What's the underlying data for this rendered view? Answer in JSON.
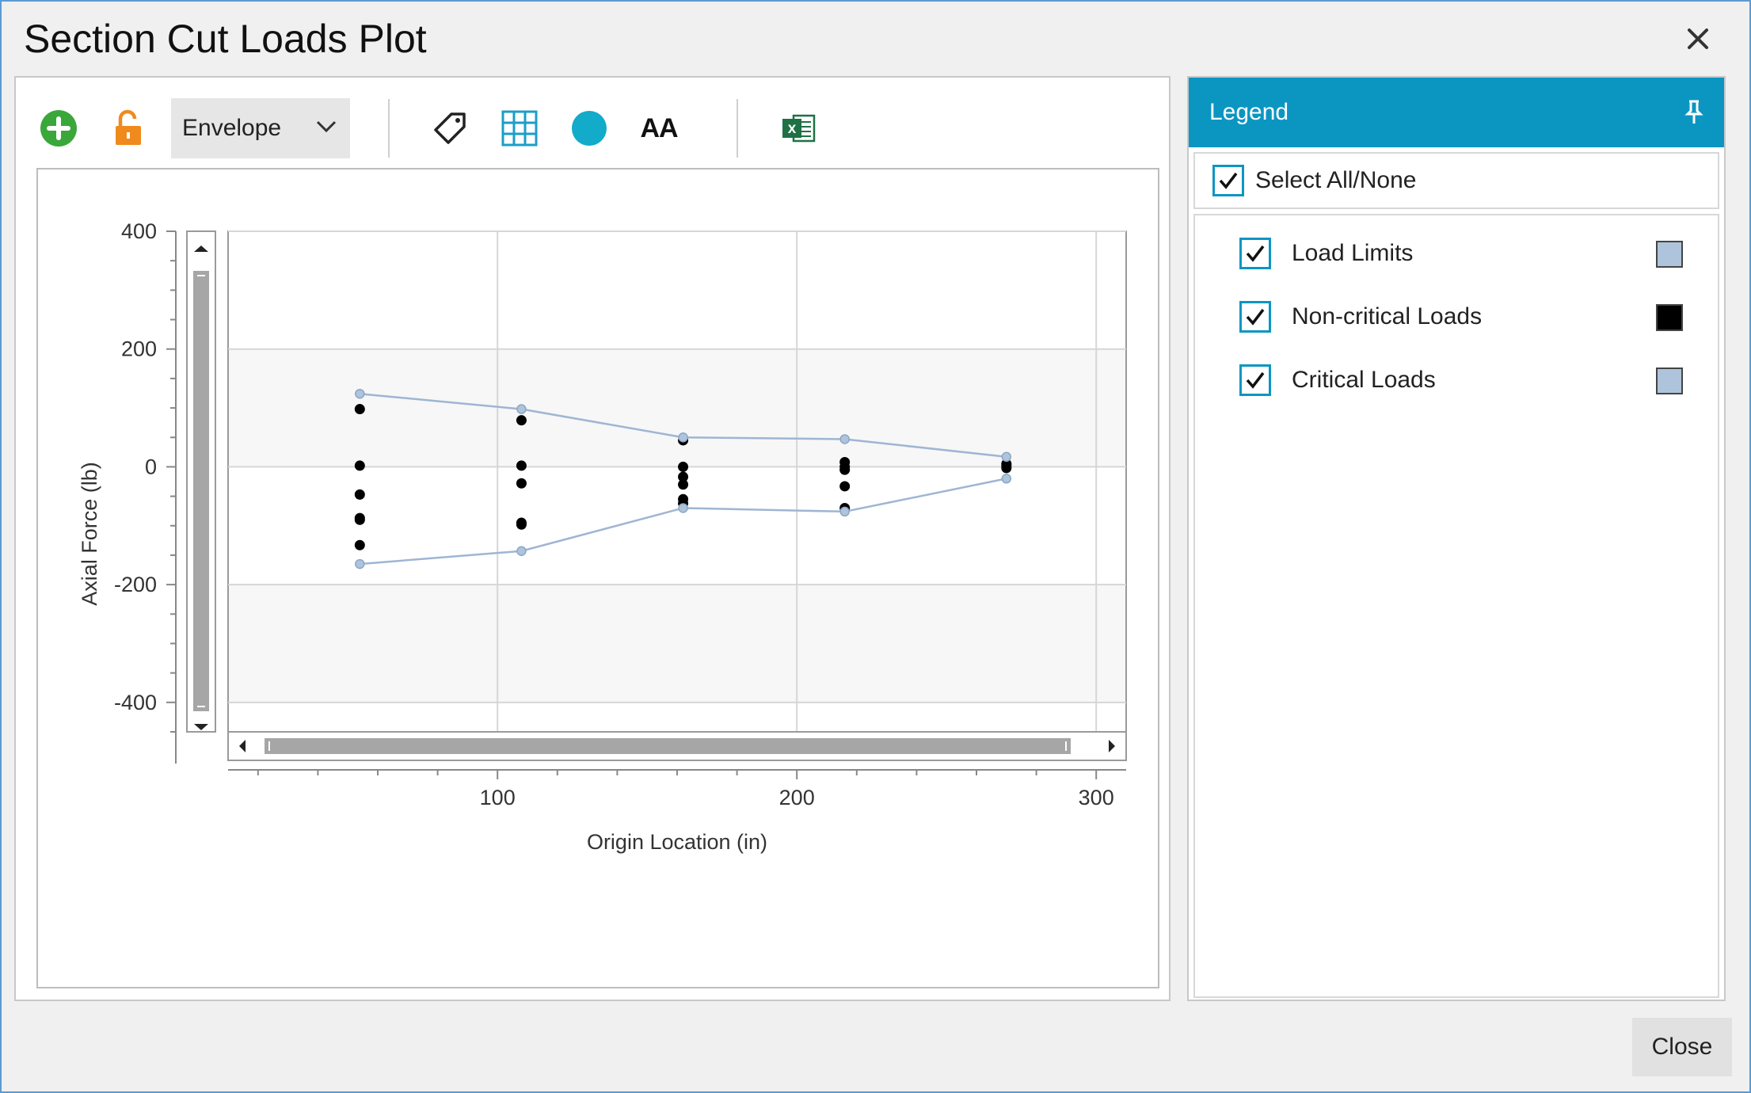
{
  "window": {
    "title": "Section Cut Loads Plot"
  },
  "toolbar": {
    "add_icon": "plus-circle-icon",
    "lock_icon": "unlock-icon",
    "dropdown_value": "Envelope",
    "tag_icon": "tag-icon",
    "grid_icon": "grid-table-icon",
    "marker_icon": "circle-marker-icon",
    "font_icon_text": "AA",
    "excel_icon": "excel-export-icon",
    "excel_letter": "x"
  },
  "legend": {
    "header": "Legend",
    "select_all": "Select All/None",
    "items": [
      {
        "label": "Load Limits",
        "color": "#aec4dc",
        "checked": true
      },
      {
        "label": "Non-critical Loads",
        "color": "#000000",
        "checked": true
      },
      {
        "label": "Critical Loads",
        "color": "#aec4dc",
        "checked": true
      }
    ]
  },
  "buttons": {
    "close": "Close"
  },
  "chart_data": {
    "type": "scatter",
    "xlabel": "Origin Location (in)",
    "ylabel": "Axial Force (lb)",
    "xlim": [
      10,
      310
    ],
    "ylim": [
      -450,
      400
    ],
    "xticks": [
      100,
      200,
      300
    ],
    "yticks": [
      400,
      200,
      0,
      -200,
      -400
    ],
    "grid": true,
    "series": [
      {
        "name": "Load Limits",
        "kind": "line",
        "color": "#9fb5d3",
        "segments": [
          {
            "x": [
              54,
              108,
              162,
              216,
              270
            ],
            "y": [
              124,
              98,
              50,
              47,
              17
            ]
          },
          {
            "x": [
              54,
              108,
              162,
              216,
              270
            ],
            "y": [
              -165,
              -143,
              -70,
              -76,
              -20
            ]
          }
        ]
      },
      {
        "name": "Non-critical Loads",
        "kind": "points",
        "color": "#000000",
        "points": [
          [
            54,
            98
          ],
          [
            54,
            2
          ],
          [
            54,
            -47
          ],
          [
            54,
            -87
          ],
          [
            54,
            -90
          ],
          [
            54,
            -133
          ],
          [
            108,
            79
          ],
          [
            108,
            2
          ],
          [
            108,
            -28
          ],
          [
            108,
            -95
          ],
          [
            108,
            -98
          ],
          [
            162,
            45
          ],
          [
            162,
            0
          ],
          [
            162,
            -17
          ],
          [
            162,
            -30
          ],
          [
            162,
            -55
          ],
          [
            162,
            -62
          ],
          [
            216,
            8
          ],
          [
            216,
            0
          ],
          [
            216,
            -5
          ],
          [
            216,
            -33
          ],
          [
            216,
            -70
          ],
          [
            270,
            5
          ],
          [
            270,
            2
          ],
          [
            270,
            -2
          ]
        ]
      },
      {
        "name": "Critical Loads",
        "kind": "points",
        "color": "#aec4dc",
        "points": [
          [
            54,
            124
          ],
          [
            108,
            98
          ],
          [
            162,
            50
          ],
          [
            216,
            47
          ],
          [
            270,
            17
          ],
          [
            54,
            -165
          ],
          [
            108,
            -143
          ],
          [
            162,
            -70
          ],
          [
            216,
            -76
          ],
          [
            270,
            -20
          ]
        ]
      }
    ]
  }
}
